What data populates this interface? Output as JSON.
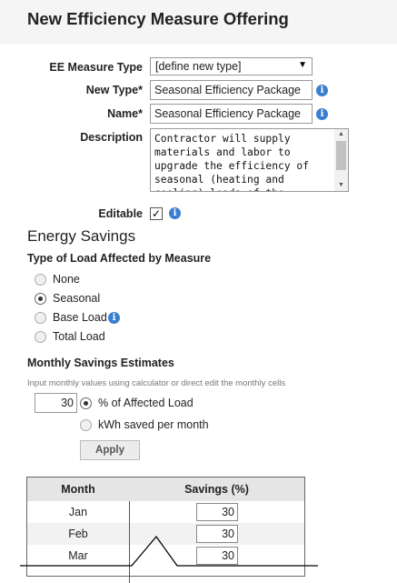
{
  "page": {
    "title": "New Efficiency Measure Offering"
  },
  "form": {
    "measure_type_label": "EE Measure Type",
    "measure_type_value": "[define new type]",
    "new_type_label": "New Type*",
    "new_type_value": "Seasonal Efficiency Package",
    "name_label": "Name*",
    "name_value": "Seasonal Efficiency Package",
    "description_label": "Description",
    "description_value": "Contractor will supply materials and labor to upgrade the efficiency of seasonal (heating and cooling) loads of the",
    "editable_label": "Editable",
    "editable_checked": true
  },
  "energy": {
    "section_title": "Energy Savings",
    "load_type_title": "Type of Load Affected by Measure",
    "load_options": [
      {
        "label": "None",
        "selected": false
      },
      {
        "label": "Seasonal",
        "selected": true
      },
      {
        "label": "Base Load",
        "selected": false
      },
      {
        "label": "Total Load",
        "selected": false
      }
    ],
    "monthly_title": "Monthly Savings Estimates",
    "help_text": "Input monthly values using calculator or direct edit the monthly cells",
    "input_value": "30",
    "unit_options": [
      {
        "label": "% of Affected Load",
        "selected": true
      },
      {
        "label": "kWh saved per month",
        "selected": false
      }
    ],
    "apply_label": "Apply"
  },
  "table": {
    "headers": [
      "Month",
      "Savings (%)"
    ],
    "rows": [
      {
        "month": "Jan",
        "value": "30"
      },
      {
        "month": "Feb",
        "value": "30"
      },
      {
        "month": "Mar",
        "value": "30"
      }
    ]
  },
  "icons": {
    "info": "info-icon",
    "dropdown": "chevron-down-icon",
    "check": "checkmark-icon"
  },
  "colors": {
    "info_blue": "#3a7fcf",
    "header_bg": "#f5f5f5",
    "table_header_bg": "#e5e5e5"
  }
}
